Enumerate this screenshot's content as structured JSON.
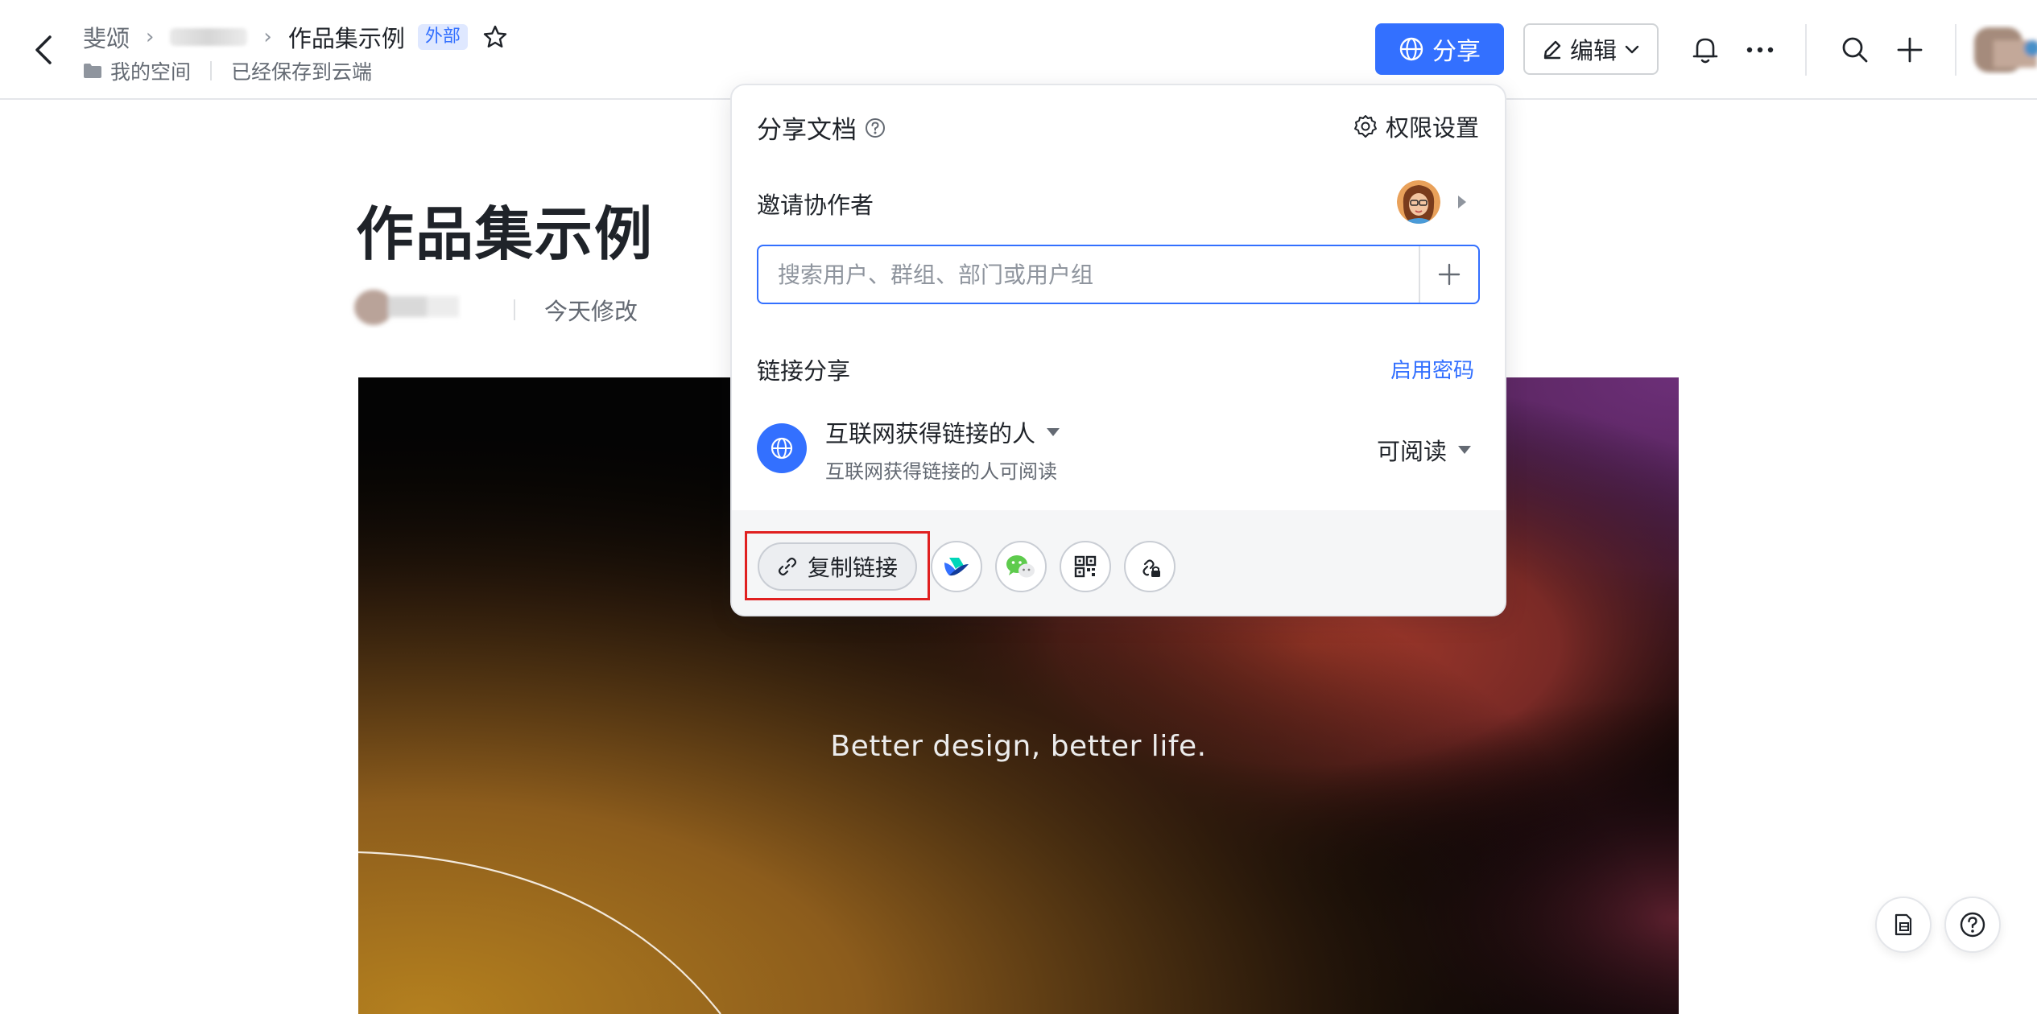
{
  "breadcrumb": {
    "root": "斐颂",
    "current": "作品集示例",
    "badge": "外部"
  },
  "subline": {
    "space": "我的空间",
    "save_status": "已经保存到云端"
  },
  "toolbar": {
    "share_label": "分享",
    "edit_label": "编辑"
  },
  "document": {
    "title": "作品集示例",
    "modified": "今天修改",
    "cover_tagline": "Better design, better life."
  },
  "share_panel": {
    "title": "分享文档",
    "permission_settings": "权限设置",
    "invite_label": "邀请协作者",
    "search_placeholder": "搜索用户、群组、部门或用户组",
    "link_share_label": "链接分享",
    "enable_password": "启用密码",
    "scope": "互联网获得链接的人",
    "scope_description": "互联网获得链接的人可阅读",
    "permission": "可阅读",
    "copy_link": "复制链接",
    "share_targets": [
      "feishu-icon",
      "wechat-icon",
      "qrcode-icon",
      "link-lock-icon"
    ]
  },
  "colors": {
    "primary": "#3370ff",
    "highlight": "#e02020",
    "text": "#1f2329",
    "subtext": "#646a73"
  }
}
